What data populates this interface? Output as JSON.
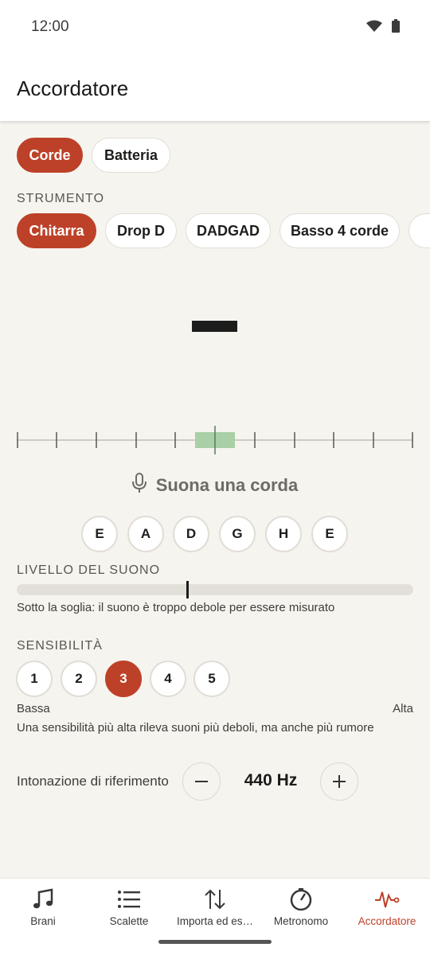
{
  "status_bar": {
    "time": "12:00",
    "icons": [
      "wifi-icon",
      "battery-icon"
    ]
  },
  "app_bar": {
    "title": "Accordatore"
  },
  "mode_tabs": [
    {
      "label": "Corde",
      "active": true
    },
    {
      "label": "Batteria",
      "active": false
    }
  ],
  "instrument": {
    "section_label": "STRUMENTO",
    "options": [
      {
        "label": "Chitarra",
        "active": true
      },
      {
        "label": "Drop D",
        "active": false
      },
      {
        "label": "DADGAD",
        "active": false
      },
      {
        "label": "Basso 4 corde",
        "active": false
      }
    ]
  },
  "tuner": {
    "status": "Suona una corda",
    "strings": [
      "E",
      "A",
      "D",
      "G",
      "H",
      "E"
    ]
  },
  "level": {
    "section_label": "LIVELLO DEL SUONO",
    "value": 0.43,
    "description": "Sotto la soglia: il suono è troppo debole per essere misurato"
  },
  "sensitivity": {
    "section_label": "SENSIBILITÀ",
    "options": [
      "1",
      "2",
      "3",
      "4",
      "5"
    ],
    "selected": "3",
    "low_label": "Bassa",
    "high_label": "Alta",
    "description": "Una sensibilità più alta rileva suoni più deboli, ma anche più rumore"
  },
  "reference_pitch": {
    "label": "Intonazione di riferimento",
    "value": "440 Hz"
  },
  "bottom_nav": [
    {
      "label": "Brani",
      "icon": "music-note-icon",
      "active": false
    },
    {
      "label": "Scalette",
      "icon": "list-icon",
      "active": false
    },
    {
      "label": "Importa ed es…",
      "icon": "import-export-icon",
      "active": false
    },
    {
      "label": "Metronomo",
      "icon": "metronome-icon",
      "active": false
    },
    {
      "label": "Accordatore",
      "icon": "tuner-pulse-icon",
      "active": true
    }
  ],
  "colors": {
    "accent": "#bd4128",
    "background": "#f6f4ef",
    "in_tune_zone": "#a9cfa6"
  }
}
